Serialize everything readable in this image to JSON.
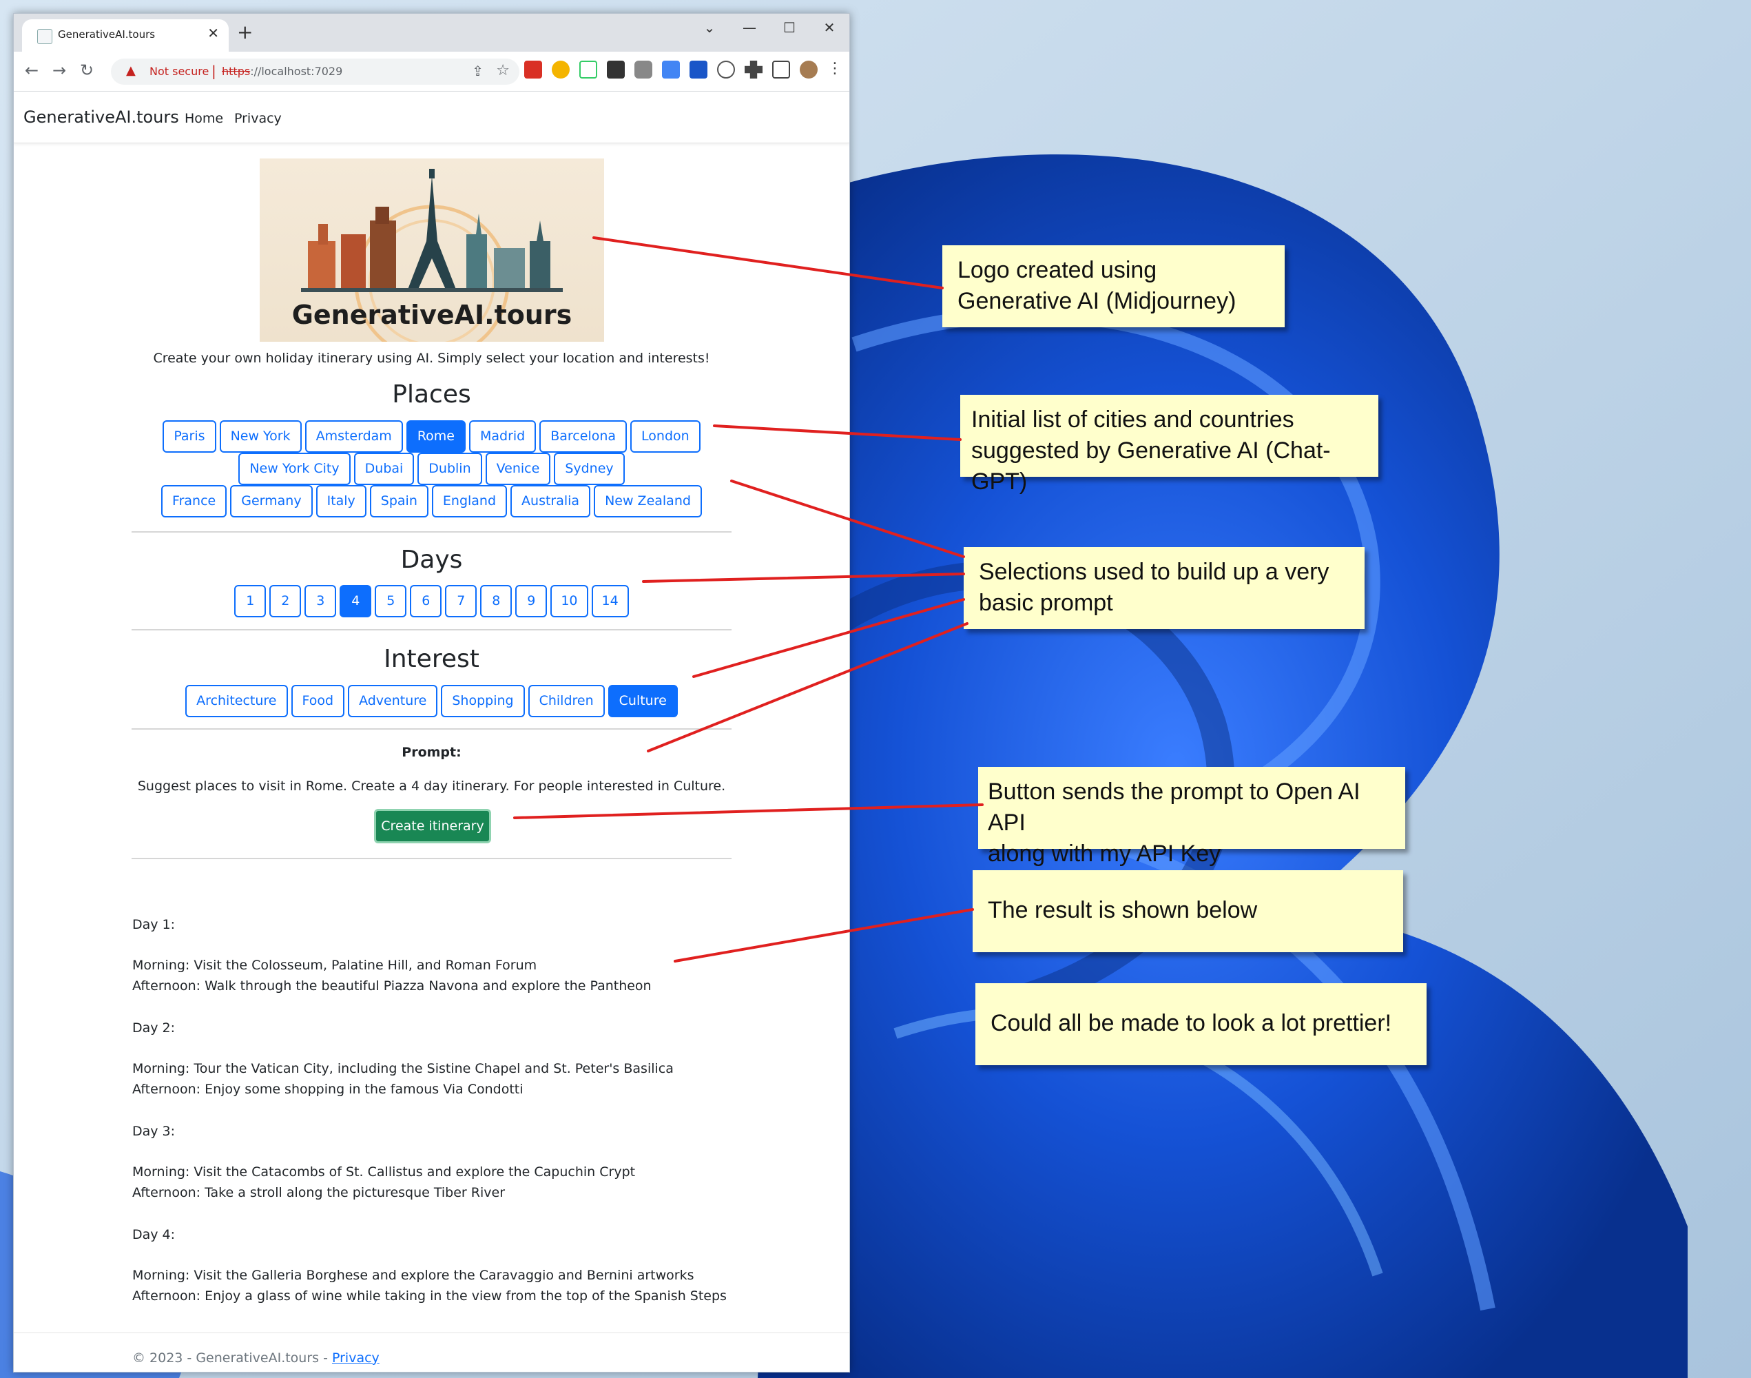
{
  "browser": {
    "tab_title": "GenerativeAI.tours",
    "not_secure": "Not secure",
    "url_scheme": "https",
    "url_rest": "://localhost:7029"
  },
  "site": {
    "brand": "GenerativeAI.tours",
    "nav": [
      "Home",
      "Privacy"
    ],
    "logo_text": "GenerativeAI.tours",
    "tagline": "Create your own holiday itinerary using AI. Simply select your location and interests!"
  },
  "places": {
    "heading": "Places",
    "rows": [
      [
        "Paris",
        "New York",
        "Amsterdam",
        "Rome",
        "Madrid",
        "Barcelona",
        "London"
      ],
      [
        "New York City",
        "Dubai",
        "Dublin",
        "Venice",
        "Sydney"
      ],
      [
        "France",
        "Germany",
        "Italy",
        "Spain",
        "England",
        "Australia",
        "New Zealand"
      ]
    ],
    "selected": "Rome"
  },
  "days": {
    "heading": "Days",
    "options": [
      "1",
      "2",
      "3",
      "4",
      "5",
      "6",
      "7",
      "8",
      "9",
      "10",
      "14"
    ],
    "selected": "4"
  },
  "interest": {
    "heading": "Interest",
    "options": [
      "Architecture",
      "Food",
      "Adventure",
      "Shopping",
      "Children",
      "Culture"
    ],
    "selected": "Culture"
  },
  "prompt": {
    "label": "Prompt:",
    "text": "Suggest places to visit in Rome. Create a 4 day itinerary. For people interested in Culture.",
    "button": "Create itinerary"
  },
  "result": [
    {
      "day": "Day 1:",
      "lines": [
        "Morning: Visit the Colosseum, Palatine Hill, and Roman Forum",
        "Afternoon: Walk through the beautiful Piazza Navona and explore the Pantheon"
      ]
    },
    {
      "day": "Day 2:",
      "lines": [
        "Morning: Tour the Vatican City, including the Sistine Chapel and St. Peter's Basilica",
        "Afternoon: Enjoy some shopping in the famous Via Condotti"
      ]
    },
    {
      "day": "Day 3:",
      "lines": [
        "Morning: Visit the Catacombs of St. Callistus and explore the Capuchin Crypt",
        "Afternoon: Take a stroll along the picturesque Tiber River"
      ]
    },
    {
      "day": "Day 4:",
      "lines": [
        "Morning: Visit the Galleria Borghese and explore the Caravaggio and Bernini artworks",
        "Afternoon: Enjoy a glass of wine while taking in the view from the top of the Spanish Steps"
      ]
    }
  ],
  "footer": {
    "text": "© 2023 - GenerativeAI.tours - ",
    "link": "Privacy"
  },
  "callouts": [
    {
      "lines": [
        "Logo created using",
        "Generative AI (Midjourney)"
      ]
    },
    {
      "lines": [
        "Initial list of cities and countries",
        "suggested by Generative AI (Chat-GPT)"
      ]
    },
    {
      "lines": [
        "Selections used to build up a very",
        "basic prompt"
      ]
    },
    {
      "lines": [
        "Button sends the prompt to Open AI API",
        "along with my API Key"
      ]
    },
    {
      "lines": [
        "The result is shown below"
      ]
    },
    {
      "lines": [
        "Could all be made to look a lot prettier!"
      ]
    }
  ],
  "colors": {
    "primary": "#0d6efd",
    "success": "#198754",
    "callout_bg": "#ffffcc",
    "arrow": "#e0201f"
  },
  "icons": [
    "back-arrow-icon",
    "forward-arrow-icon",
    "reload-icon",
    "warning-icon",
    "share-icon",
    "star-icon",
    "extensions-icon",
    "menu-icon"
  ]
}
